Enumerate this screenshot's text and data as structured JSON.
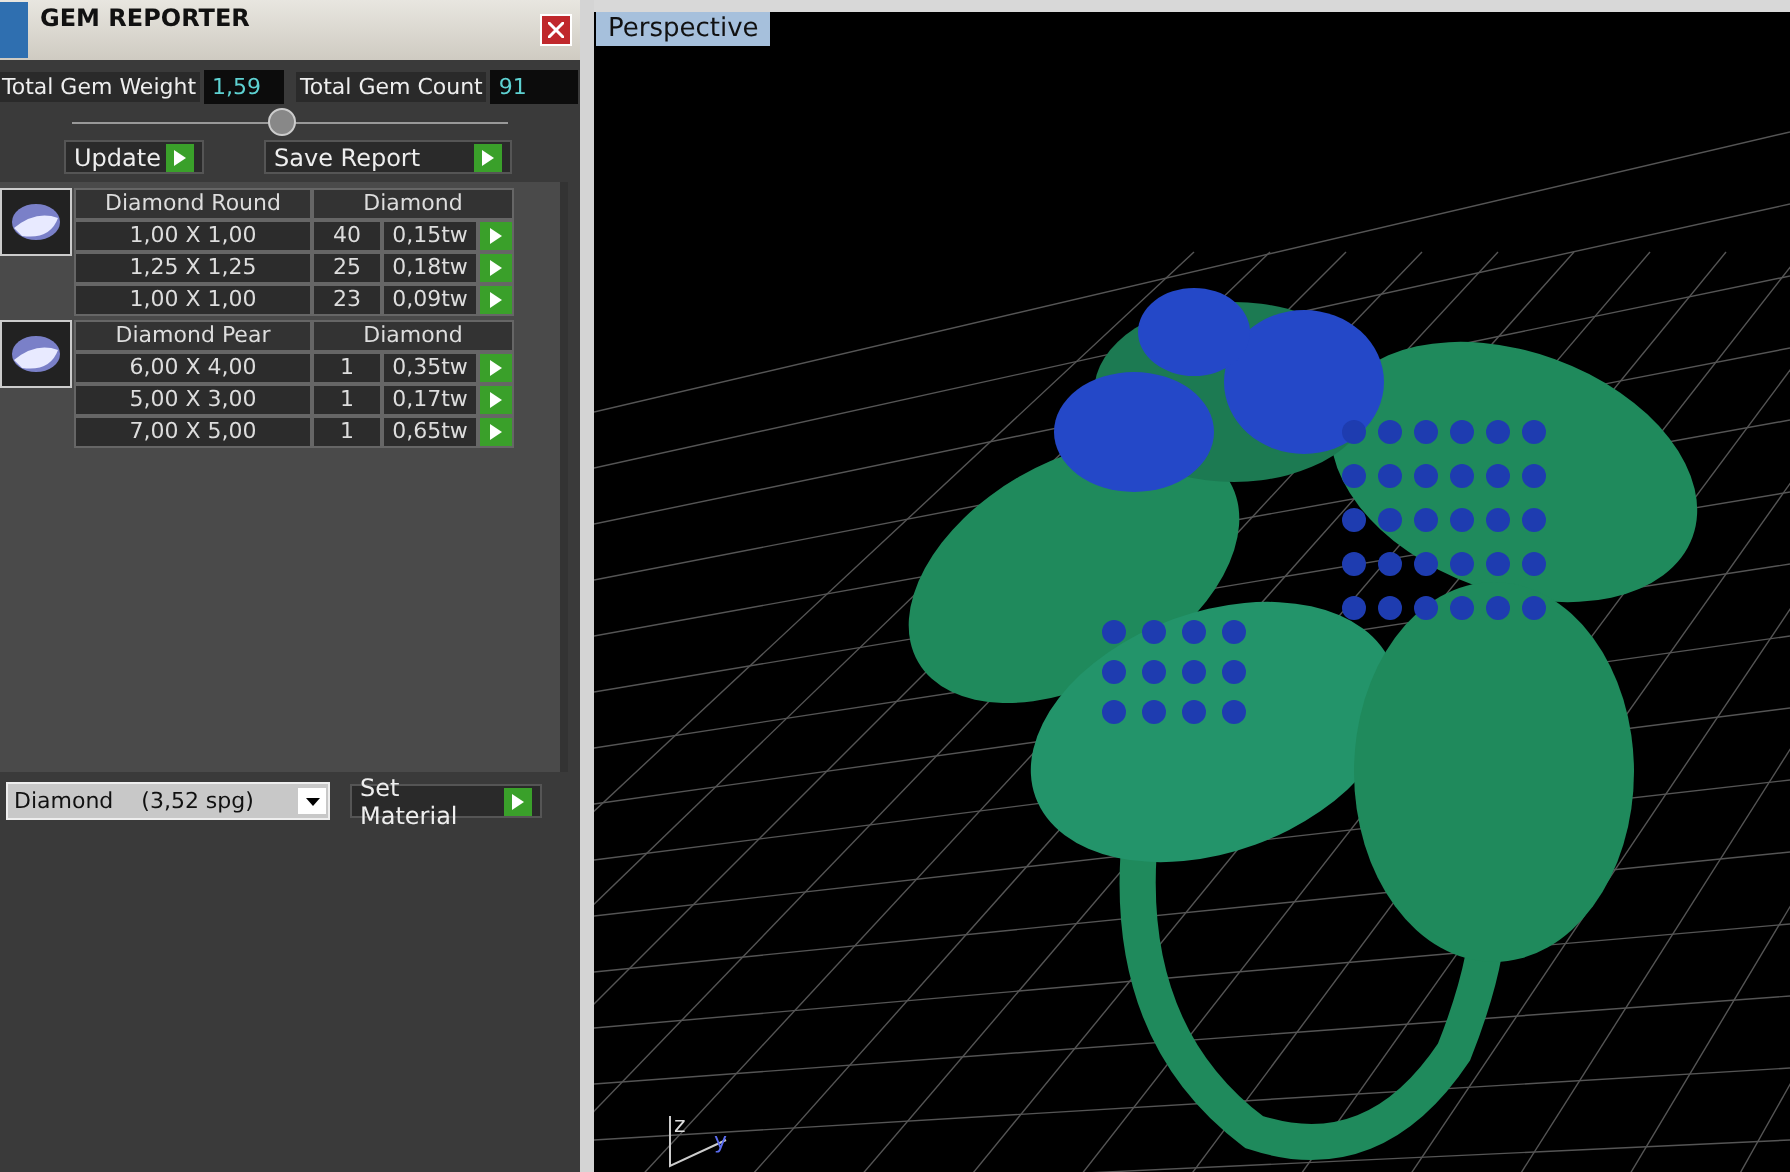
{
  "panel": {
    "title": "GEM REPORTER",
    "stats": [
      {
        "label": "Total Gem Weight",
        "value": "1,59"
      },
      {
        "label": "Total Gem Count",
        "value": "91"
      }
    ],
    "buttons": [
      "Update",
      "Save Report"
    ],
    "groups": [
      {
        "name": "Diamond Round",
        "material": "Diamond",
        "rows": [
          {
            "size": "1,00 X 1,00",
            "count": "40",
            "weight": "0,15tw"
          },
          {
            "size": "1,25 X 1,25",
            "count": "25",
            "weight": "0,18tw"
          },
          {
            "size": "1,00 X 1,00",
            "count": "23",
            "weight": "0,09tw"
          }
        ]
      },
      {
        "name": "Diamond Pear",
        "material": "Diamond",
        "rows": [
          {
            "size": "6,00 X 4,00",
            "count": "1",
            "weight": "0,35tw"
          },
          {
            "size": "5,00 X 3,00",
            "count": "1",
            "weight": "0,17tw"
          },
          {
            "size": "7,00 X 5,00",
            "count": "1",
            "weight": "0,65tw"
          }
        ]
      }
    ],
    "material_select": {
      "value": "Diamond",
      "density": "(3,52 spg)"
    },
    "set_button": "Set Material"
  },
  "viewport": {
    "label": "Perspective",
    "axes": [
      "z",
      "y"
    ]
  }
}
